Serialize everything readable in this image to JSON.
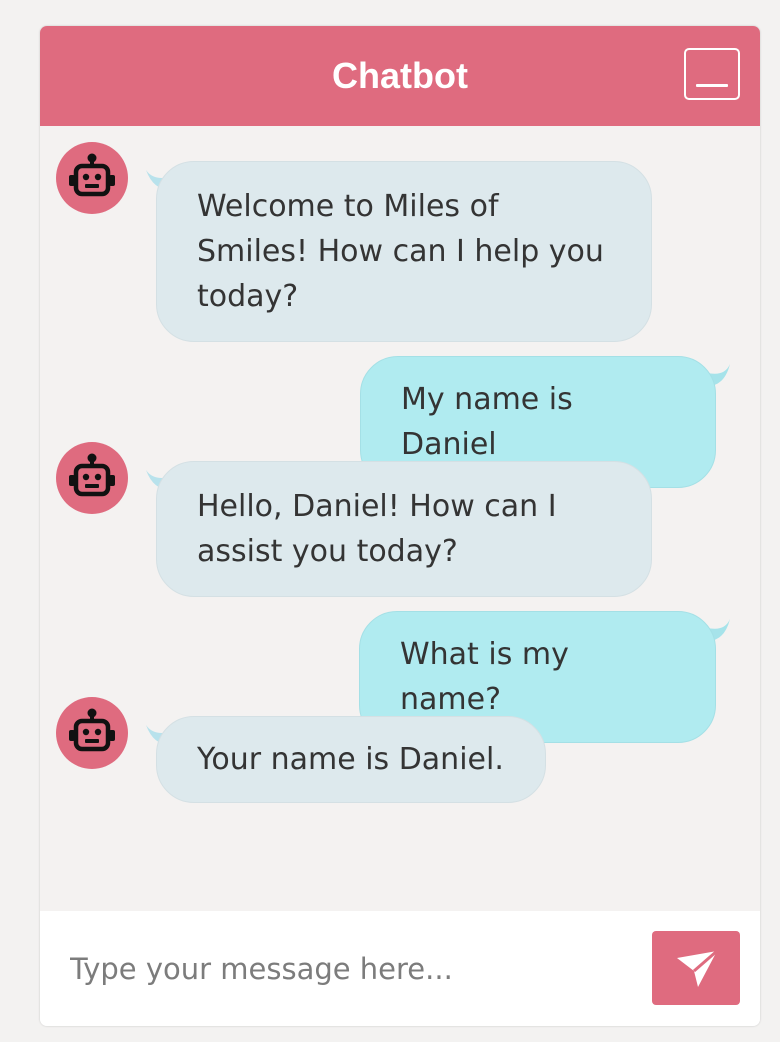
{
  "header": {
    "title": "Chatbot",
    "minimize_icon": "minimize-icon"
  },
  "messages": [
    {
      "sender": "bot",
      "text": "Welcome to Miles of Smiles! How can I help you today?"
    },
    {
      "sender": "user",
      "text": "My name is Daniel"
    },
    {
      "sender": "bot",
      "text": "Hello, Daniel! How can I assist you today?"
    },
    {
      "sender": "user",
      "text": "What is my name?"
    },
    {
      "sender": "bot",
      "text": "Your name is Daniel."
    }
  ],
  "input": {
    "value": "",
    "placeholder": "Type your message here..."
  },
  "send": {
    "icon": "send-icon"
  },
  "colors": {
    "accent": "#df6b7f",
    "bot_bubble": "#dde9ed",
    "user_bubble": "#b0ebf0",
    "background": "#f4f2f1"
  }
}
